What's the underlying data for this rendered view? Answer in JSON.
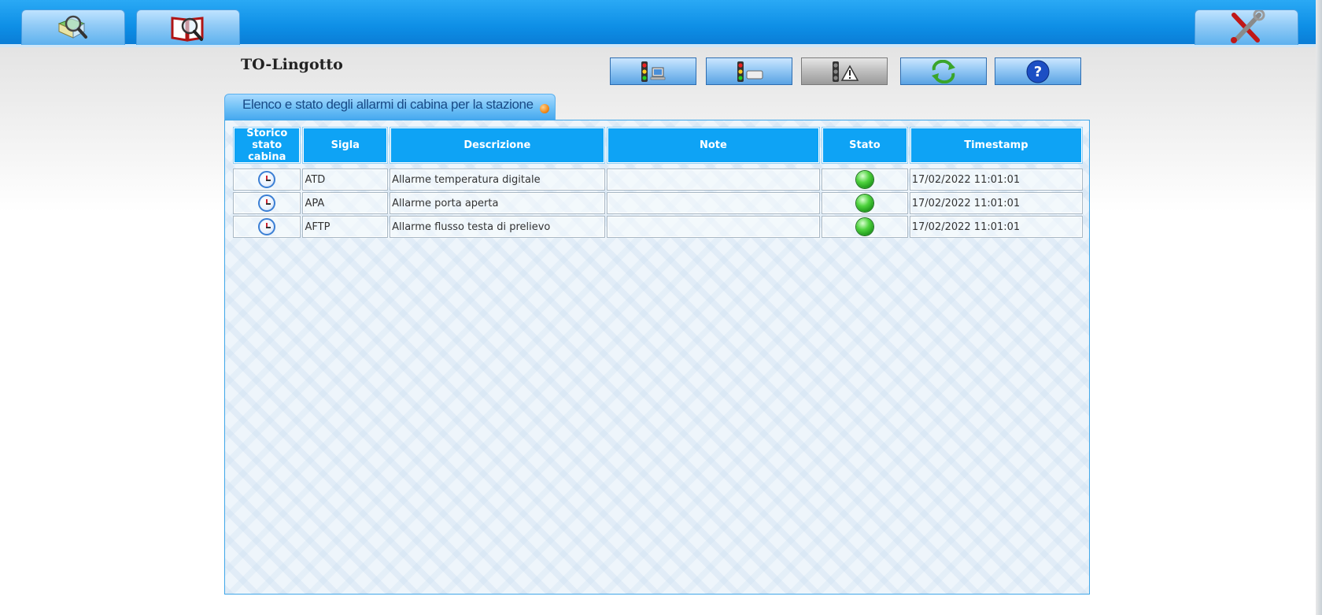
{
  "nav": {
    "tabs": [
      {
        "name": "map-search-icon"
      },
      {
        "name": "book-search-icon"
      }
    ],
    "settings_icon": "tools-icon"
  },
  "station": {
    "title": "TO-Lingotto"
  },
  "toolbar": {
    "buttons": [
      {
        "icon": "traffic-light-computer-icon"
      },
      {
        "icon": "traffic-light-device-icon"
      },
      {
        "icon": "traffic-light-warning-icon"
      },
      {
        "icon": "refresh-icon"
      },
      {
        "icon": "help-icon"
      }
    ]
  },
  "section": {
    "title": "Elenco e stato degli allarmi di cabina per la stazione"
  },
  "table": {
    "headers": {
      "history": "Storico stato cabina",
      "code": "Sigla",
      "description": "Descrizione",
      "notes": "Note",
      "status": "Stato",
      "timestamp": "Timestamp"
    },
    "rows": [
      {
        "code": "ATD",
        "description": "Allarme temperatura digitale",
        "notes": "",
        "status": "green",
        "timestamp": "17/02/2022 11:01:01"
      },
      {
        "code": "APA",
        "description": "Allarme porta aperta",
        "notes": "",
        "status": "green",
        "timestamp": "17/02/2022 11:01:01"
      },
      {
        "code": "AFTP",
        "description": "Allarme flusso testa di prelievo",
        "notes": "",
        "status": "green",
        "timestamp": "17/02/2022 11:01:01"
      }
    ]
  },
  "colors": {
    "header_blue": "#0ea3f5",
    "status_ok": "#2fbf2a",
    "accent_orange": "#f08a1a"
  }
}
